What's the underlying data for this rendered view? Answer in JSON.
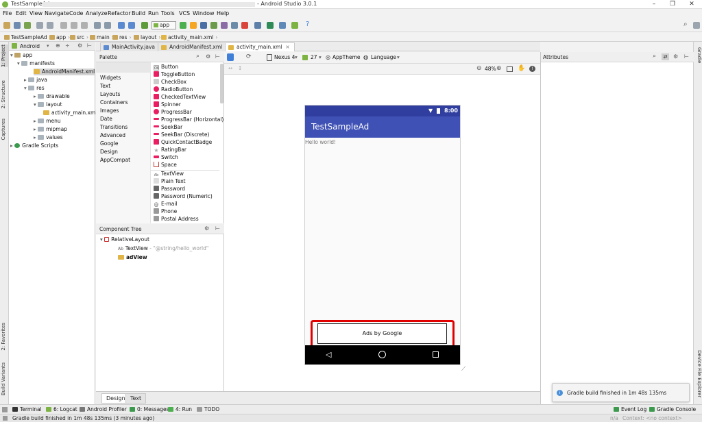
{
  "window": {
    "title_prefix": "TestSampleAd - ",
    "title_center": "- Android Studio 3.0.1",
    "minimize": "–",
    "maximize": "❐",
    "close": "✕"
  },
  "menu": [
    "File",
    "Edit",
    "View",
    "Navigate",
    "Code",
    "Analyze",
    "Refactor",
    "Build",
    "Run",
    "Tools",
    "VCS",
    "Window",
    "Help"
  ],
  "toolbar": {
    "run_config": "app"
  },
  "breadcrumb": [
    "TestSampleAd",
    "app",
    "src",
    "main",
    "res",
    "layout",
    "activity_main.xml"
  ],
  "project": {
    "view_mode": "Android",
    "items": [
      {
        "label": "app",
        "depth": 0
      },
      {
        "label": "manifests",
        "depth": 1
      },
      {
        "label": "AndroidManifest.xml",
        "depth": 2
      },
      {
        "label": "java",
        "depth": 1
      },
      {
        "label": "res",
        "depth": 1
      },
      {
        "label": "drawable",
        "depth": 2
      },
      {
        "label": "layout",
        "depth": 2
      },
      {
        "label": "activity_main.xml",
        "depth": 3
      },
      {
        "label": "menu",
        "depth": 2
      },
      {
        "label": "mipmap",
        "depth": 2
      },
      {
        "label": "values",
        "depth": 2
      },
      {
        "label": "Gradle Scripts",
        "depth": 0
      }
    ]
  },
  "side_left": {
    "project": "1: Project",
    "structure": "2: Structure",
    "captures": "Captures",
    "favorites": "2: Favorites",
    "build_variants": "Build Variants"
  },
  "side_right": {
    "gradle": "Gradle",
    "device_explorer": "Device File Explorer"
  },
  "tabs": [
    {
      "label": "MainActivity.java",
      "active": false
    },
    {
      "label": "AndroidManifest.xml",
      "active": false
    },
    {
      "label": "activity_main.xml",
      "active": true
    }
  ],
  "palette": {
    "title": "Palette",
    "categories": [
      "Widgets",
      "Text",
      "Layouts",
      "Containers",
      "Images",
      "Date",
      "Transitions",
      "Advanced",
      "Google",
      "Design",
      "AppCompat"
    ],
    "widgets": [
      {
        "label": "Button",
        "icon": "OK"
      },
      {
        "label": "ToggleButton",
        "icon": ""
      },
      {
        "label": "CheckBox",
        "icon": ""
      },
      {
        "label": "RadioButton",
        "icon": ""
      },
      {
        "label": "CheckedTextView",
        "icon": ""
      },
      {
        "label": "Spinner",
        "icon": ""
      },
      {
        "label": "ProgressBar",
        "icon": ""
      },
      {
        "label": "ProgressBar (Horizontal)",
        "icon": ""
      },
      {
        "label": "SeekBar",
        "icon": ""
      },
      {
        "label": "SeekBar (Discrete)",
        "icon": ""
      },
      {
        "label": "QuickContactBadge",
        "icon": ""
      },
      {
        "label": "RatingBar",
        "icon": ""
      },
      {
        "label": "Switch",
        "icon": ""
      },
      {
        "label": "Space",
        "icon": ""
      },
      {
        "label": "TextView",
        "icon": "Ab"
      },
      {
        "label": "Plain Text",
        "icon": ""
      },
      {
        "label": "Password",
        "icon": ""
      },
      {
        "label": "Password (Numeric)",
        "icon": ""
      },
      {
        "label": "E-mail",
        "icon": ""
      },
      {
        "label": "Phone",
        "icon": ""
      },
      {
        "label": "Postal Address",
        "icon": ""
      }
    ]
  },
  "component_tree": {
    "title": "Component Tree",
    "root": "RelativeLayout",
    "textview_label": "TextView",
    "textview_value": "- \"@string/hello_world\"",
    "adview": "adView"
  },
  "layout_toolbar": {
    "device": "Nexus 4",
    "api": "27",
    "theme": "AppTheme",
    "language": "Language",
    "zoom": "48%"
  },
  "phone": {
    "time": "8:00",
    "app_title": "TestSampleAd",
    "hello": "Hello world!",
    "ad_label": "Ads by Google"
  },
  "attributes": {
    "title": "Attributes"
  },
  "design_tabs": [
    "Design",
    "Text"
  ],
  "notification": "Gradle build finished in 1m 48s 135ms",
  "bottom_tools": {
    "terminal": "Terminal",
    "logcat": "6: Logcat",
    "profiler": "Android Profiler",
    "messages": "0: Messages",
    "run": "4: Run",
    "todo": "TODO",
    "event_log": "Event Log",
    "gradle_console": "Gradle Console"
  },
  "status": {
    "message": "Gradle build finished in 1m 48s 135ms (3 minutes ago)",
    "na": "n/a",
    "context": "Context: <no context>"
  },
  "colors": {
    "primary": "#3f51b5",
    "primary_dark": "#303f9f",
    "highlight": "#e00000"
  }
}
